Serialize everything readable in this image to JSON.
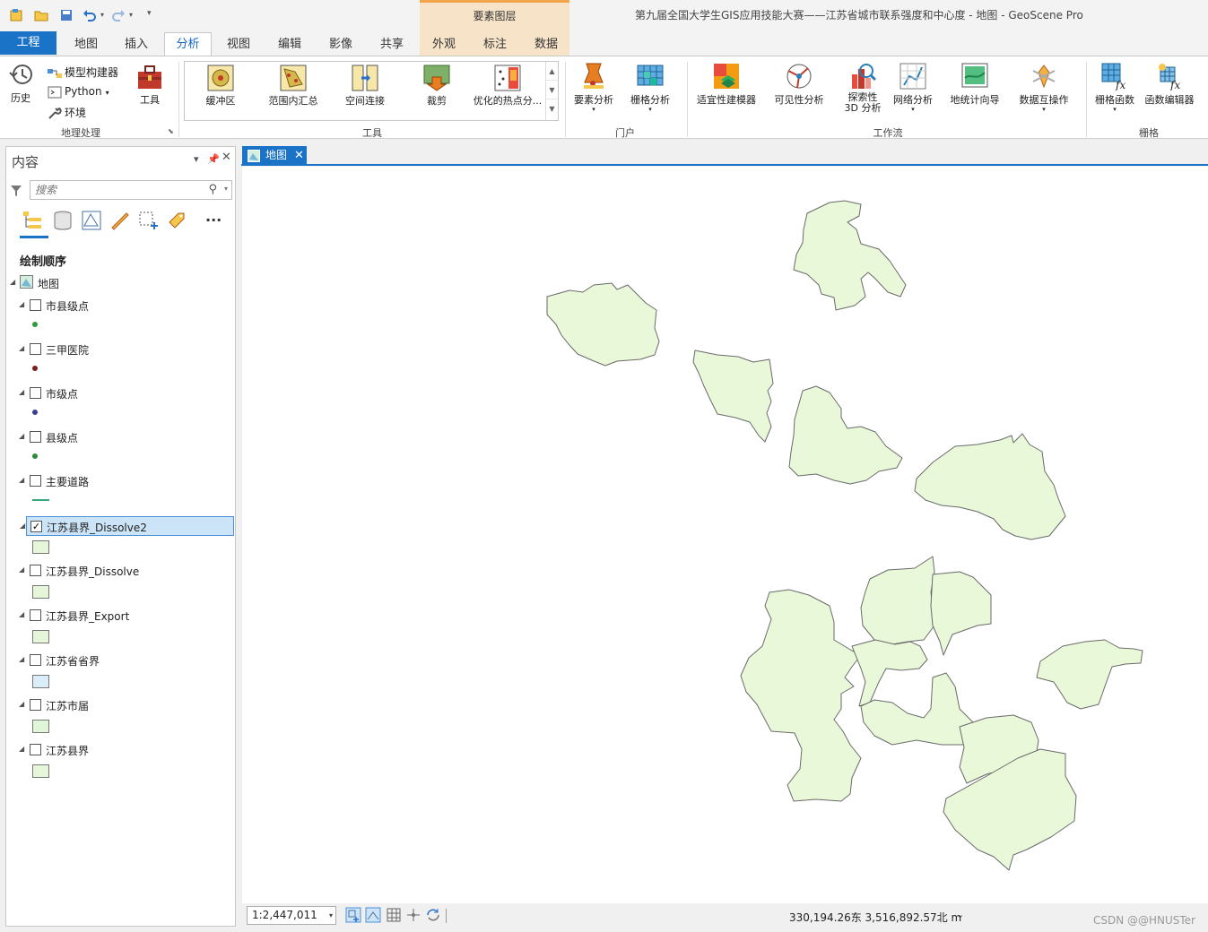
{
  "window": {
    "title": "第九届全国大学生GIS应用技能大赛——江苏省城市联系强度和中心度 - 地图 - GeoScene Pro",
    "context_tab": "要素图层"
  },
  "tabs": [
    "工程",
    "地图",
    "插入",
    "分析",
    "视图",
    "编辑",
    "影像",
    "共享",
    "外观",
    "标注",
    "数据"
  ],
  "ribbon": {
    "geoprocessing": {
      "label": "地理处理",
      "history": "历史",
      "model_builder": "模型构建器",
      "python": "Python",
      "environments": "环境",
      "tools": "工具"
    },
    "tools_group": {
      "label": "工具",
      "items": [
        "缓冲区",
        "范围内汇总",
        "空间连接",
        "裁剪",
        "优化的热点分..."
      ]
    },
    "portal": {
      "label": "门户",
      "items": [
        "要素分析",
        "栅格分析"
      ]
    },
    "workflows": {
      "label": "工作流",
      "items": [
        "适宜性建模器",
        "可见性分析",
        "探索性 3D 分析",
        "网络分析",
        "地统计向导",
        "数据互操作"
      ]
    },
    "raster": {
      "label": "栅格",
      "items": [
        "栅格函数",
        "函数编辑器"
      ]
    }
  },
  "contents": {
    "title": "内容",
    "search_placeholder": "搜索",
    "draw_order": "绘制顺序",
    "map_name": "地图",
    "layers": [
      {
        "name": "市县级点",
        "checked": false,
        "symbol_color": "#2e9a3c"
      },
      {
        "name": "三甲医院",
        "checked": false,
        "symbol_color": "#7a1f1f"
      },
      {
        "name": "市级点",
        "checked": false,
        "symbol_color": "#3a3f8f"
      },
      {
        "name": "县级点",
        "checked": false,
        "symbol_color": "#2e8a3c"
      },
      {
        "name": "主要道路",
        "checked": false,
        "symbol_color": "#3aa87a"
      },
      {
        "name": "江苏县界_Dissolve2",
        "checked": true,
        "selected": true,
        "symbol_color": "#e6f7d9"
      },
      {
        "name": "江苏县界_Dissolve",
        "checked": false,
        "symbol_color": "#e6f7d9"
      },
      {
        "name": "江苏县界_Export",
        "checked": false,
        "symbol_color": "#e6f7d9"
      },
      {
        "name": "江苏省省界",
        "checked": false,
        "symbol_color": "#d9eef9"
      },
      {
        "name": "江苏市届",
        "checked": false,
        "symbol_color": "#e0f6d9"
      },
      {
        "name": "江苏县界",
        "checked": false,
        "symbol_color": "#e6f7d9"
      }
    ],
    "check_mark": "✓"
  },
  "map": {
    "tab_label": "地图",
    "close_glyph": "✕",
    "fill_color": "#e9f8d8",
    "stroke_color": "#6a6a6a"
  },
  "status": {
    "scale": "1:2,447,011",
    "coordinates": "330,194.26东 3,516,892.57北 m",
    "watermark": "CSDN @@HNUSTer"
  }
}
